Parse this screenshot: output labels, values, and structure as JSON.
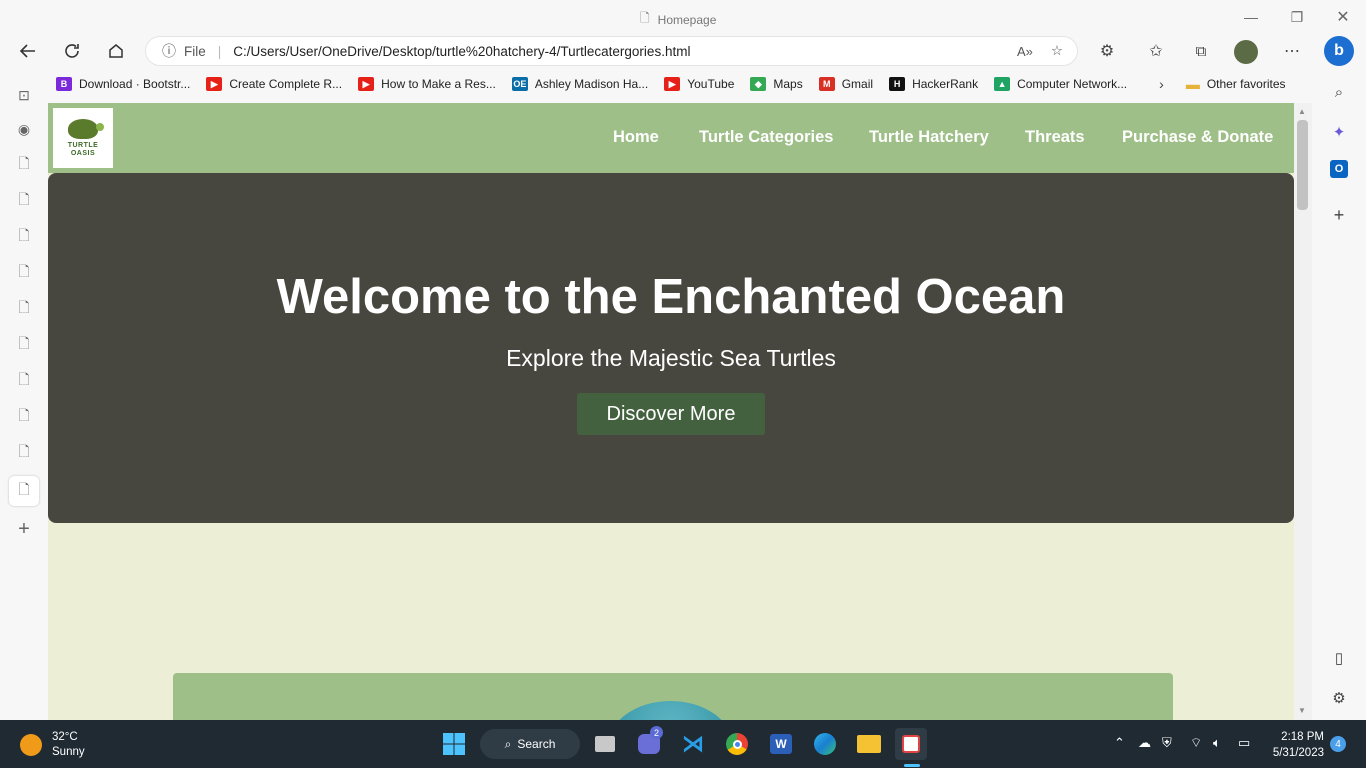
{
  "window": {
    "title": "Homepage",
    "minimize_icon": "minimize-icon",
    "maximize_icon": "restore-icon",
    "close_icon": "close-icon"
  },
  "address": {
    "protocol_label": "File",
    "url": "C:/Users/User/OneDrive/Desktop/turtle%20hatchery-4/Turtlecatergories.html"
  },
  "bookmarks": [
    {
      "label": "Download · Bootstr...",
      "icon": "B",
      "color": "#7a2ad8"
    },
    {
      "label": "Create Complete R...",
      "icon": "▶",
      "color": "#e62117"
    },
    {
      "label": "How to Make a Res...",
      "icon": "▶",
      "color": "#e62117"
    },
    {
      "label": "Ashley Madison Ha...",
      "icon": "OE",
      "color": "#0a6ea8"
    },
    {
      "label": "YouTube",
      "icon": "▶",
      "color": "#e62117"
    },
    {
      "label": "Maps",
      "icon": "◆",
      "color": "#34a853"
    },
    {
      "label": "Gmail",
      "icon": "M",
      "color": "#d93025"
    },
    {
      "label": "HackerRank",
      "icon": "H",
      "color": "#111111"
    },
    {
      "label": "Computer Network...",
      "icon": "▲",
      "color": "#1fa463"
    }
  ],
  "other_favorites": "Other favorites",
  "site": {
    "logo_text_1": "TURTLE",
    "logo_text_2": "OASIS",
    "nav": [
      "Home",
      "Turtle Categories",
      "Turtle Hatchery",
      "Threats",
      "Purchase & Donate"
    ],
    "hero_title": "Welcome to the Enchanted Ocean",
    "hero_subtitle": "Explore the Majestic Sea Turtles",
    "hero_button": "Discover More"
  },
  "colors": {
    "nav_bg": "#9fbf88",
    "hero_bg": "#47473f",
    "page_bg": "#ecefd6",
    "button_bg": "#44613f"
  },
  "taskbar": {
    "temperature": "32°C",
    "weather": "Sunny",
    "search_label": "Search",
    "teams_badge": "2",
    "time": "2:18 PM",
    "date": "5/31/2023",
    "notification_count": "4"
  }
}
